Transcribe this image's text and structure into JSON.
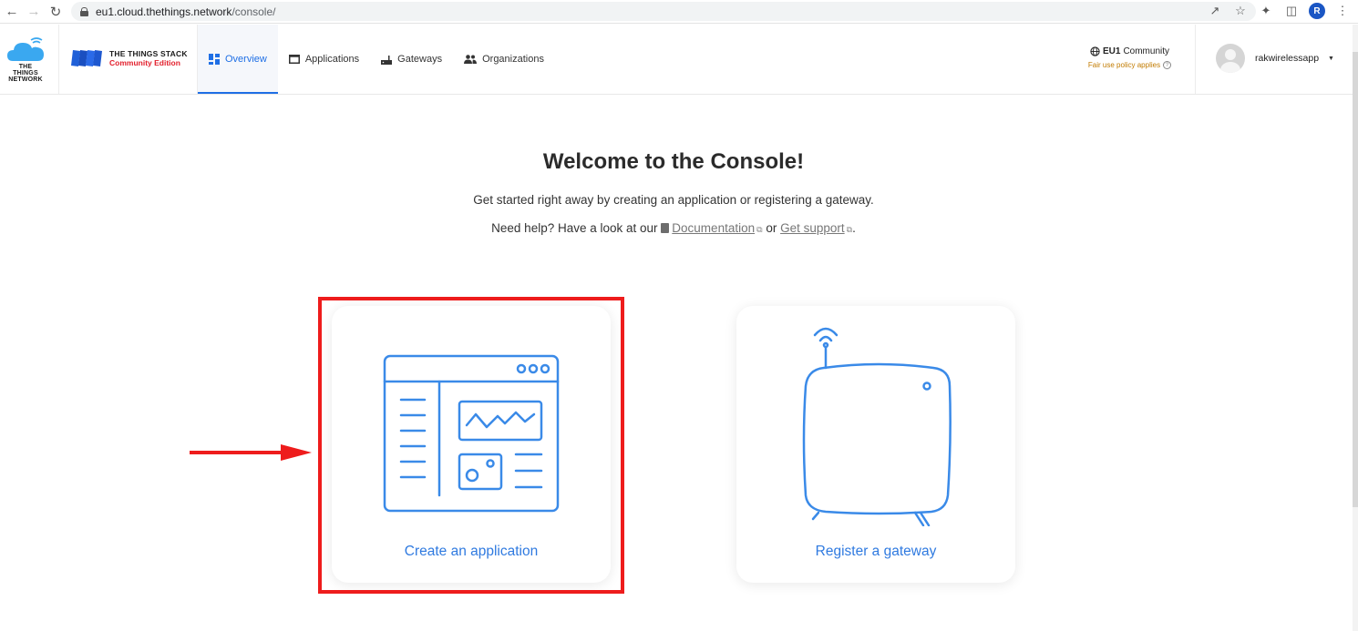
{
  "browser": {
    "url_host": "eu1.cloud.thethings.network",
    "url_path": "/console/",
    "profile_initial": "R"
  },
  "header": {
    "ttn_logo_text": "THE THINGS NETWORK",
    "tts_title": "THE THINGS STACK",
    "tts_subtitle": "Community Edition",
    "nav": [
      {
        "label": "Overview",
        "icon": "grid-icon",
        "active": true
      },
      {
        "label": "Applications",
        "icon": "window-icon",
        "active": false
      },
      {
        "label": "Gateways",
        "icon": "router-icon",
        "active": false
      },
      {
        "label": "Organizations",
        "icon": "people-icon",
        "active": false
      }
    ],
    "cluster_name": "EU1",
    "cluster_type": "Community",
    "fair_use": "Fair use policy applies",
    "username": "rakwirelessapp"
  },
  "main": {
    "title": "Welcome to the Console!",
    "subtitle": "Get started right away by creating an application or registering a gateway.",
    "help_prefix": "Need help? Have a look at our",
    "doc_link": "Documentation",
    "or_text": "or",
    "support_link": "Get support",
    "period": "."
  },
  "cards": {
    "create_app": "Create an application",
    "register_gateway": "Register a gateway"
  },
  "colors": {
    "accent": "#1f6fe5",
    "illustration": "#3a8ae8",
    "highlight": "#ee1c1c",
    "brand_red": "#e21e2b"
  }
}
